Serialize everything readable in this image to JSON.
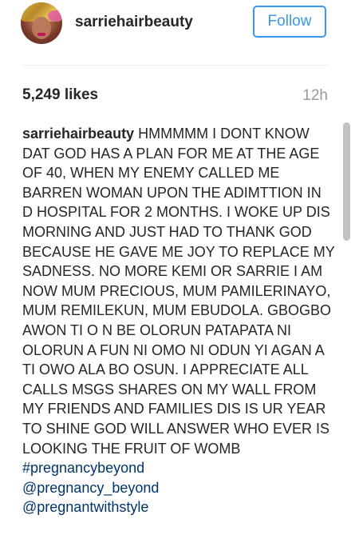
{
  "post": {
    "username": "sarriehairbeauty",
    "follow_label": "Follow",
    "likes": "5,249 likes",
    "time": "12h",
    "caption": {
      "author": "sarriehairbeauty",
      "text": "HMMMMM I DONT KNOW DAT GOD HAS A PLAN FOR ME AT THE AGE OF 40, WHEN MY ENEMY CALLED ME BARREN WOMAN UPON THE ADIMTTION IN D HOSPITAL FOR 2 MONTHS. I WOKE UP DIS MORNING AND JUST HAD TO THANK GOD BECAUSE HE GAVE ME JOY TO REPLACE MY SADNESS. NO MORE KEMI OR SARRIE I AM NOW MUM PRECIOUS, MUM PAMILERINAYO, MUM REMILEKUN, MUM EBUDOLA. GBOGBO AWON TI O N BE OLORUN PATAPATA NI OLORUN A FUN NI OMO NI ODUN YI AGAN A TI OWO ALA BO OSUN. I APPRECIATE ALL CALLS MSGS SHARES ON MY WALL FROM MY FRIENDS AND FAMILIES DIS IS UR YEAR TO SHINE GOD WILL ANSWER WHO EVER IS LOOKING THE FRUIT OF WOMB",
      "hashtag": "#pregnancybeyond",
      "mention1": "@pregnancy_beyond",
      "mention2": "@pregnantwithstyle"
    }
  },
  "colors": {
    "follow_blue": "#3897f0",
    "link_navy": "#003569",
    "text": "#262626",
    "muted": "#999999",
    "divider": "#efefef",
    "scrollbar": "#c1c1c1"
  }
}
